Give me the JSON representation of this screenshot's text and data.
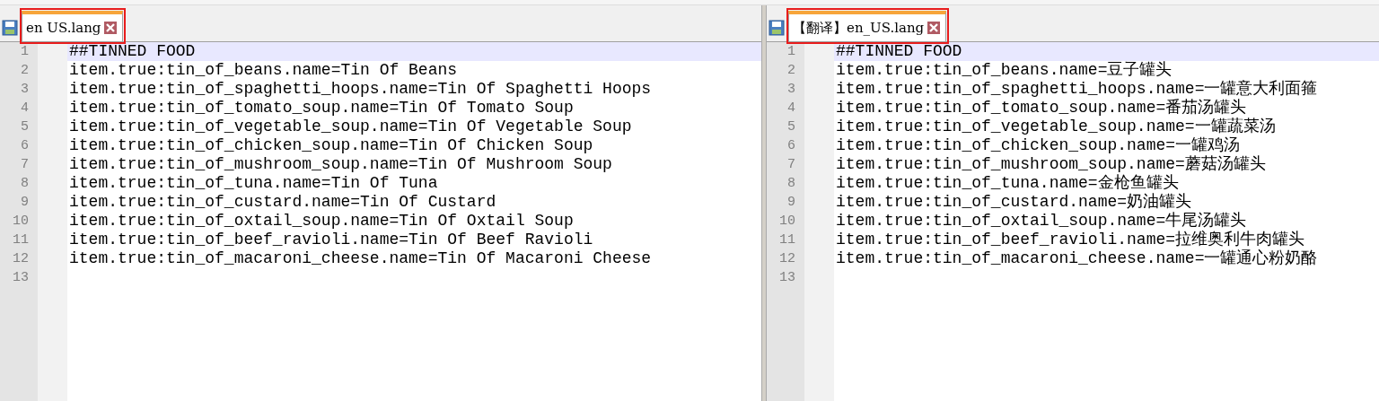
{
  "panes": [
    {
      "tab": {
        "label": "en US.lang",
        "selected": true,
        "highlighted": true
      },
      "lines": [
        {
          "number": "1",
          "text": "##TINNED FOOD",
          "current": true
        },
        {
          "number": "2",
          "text": "item.true:tin_of_beans.name=Tin Of Beans",
          "current": false
        },
        {
          "number": "3",
          "text": "item.true:tin_of_spaghetti_hoops.name=Tin Of Spaghetti Hoops",
          "current": false
        },
        {
          "number": "4",
          "text": "item.true:tin_of_tomato_soup.name=Tin Of Tomato Soup",
          "current": false
        },
        {
          "number": "5",
          "text": "item.true:tin_of_vegetable_soup.name=Tin Of Vegetable Soup",
          "current": false
        },
        {
          "number": "6",
          "text": "item.true:tin_of_chicken_soup.name=Tin Of Chicken Soup",
          "current": false
        },
        {
          "number": "7",
          "text": "item.true:tin_of_mushroom_soup.name=Tin Of Mushroom Soup",
          "current": false
        },
        {
          "number": "8",
          "text": "item.true:tin_of_tuna.name=Tin Of Tuna",
          "current": false
        },
        {
          "number": "9",
          "text": "item.true:tin_of_custard.name=Tin Of Custard",
          "current": false
        },
        {
          "number": "10",
          "text": "item.true:tin_of_oxtail_soup.name=Tin Of Oxtail Soup",
          "current": false
        },
        {
          "number": "11",
          "text": "item.true:tin_of_beef_ravioli.name=Tin Of Beef Ravioli",
          "current": false
        },
        {
          "number": "12",
          "text": "item.true:tin_of_macaroni_cheese.name=Tin Of Macaroni Cheese",
          "current": false
        },
        {
          "number": "13",
          "current": false
        }
      ]
    },
    {
      "tab": {
        "label": "【翻译】en_US.lang",
        "selected": true,
        "highlighted": true
      },
      "lines": [
        {
          "number": "1",
          "text": "##TINNED FOOD",
          "current": true
        },
        {
          "number": "2",
          "text": "item.true:tin_of_beans.name=豆子罐头",
          "current": false
        },
        {
          "number": "3",
          "text": "item.true:tin_of_spaghetti_hoops.name=一罐意大利面箍",
          "current": false
        },
        {
          "number": "4",
          "text": "item.true:tin_of_tomato_soup.name=番茄汤罐头",
          "current": false
        },
        {
          "number": "5",
          "text": "item.true:tin_of_vegetable_soup.name=一罐蔬菜汤",
          "current": false
        },
        {
          "number": "6",
          "text": "item.true:tin_of_chicken_soup.name=一罐鸡汤",
          "current": false
        },
        {
          "number": "7",
          "text": "item.true:tin_of_mushroom_soup.name=蘑菇汤罐头",
          "current": false
        },
        {
          "number": "8",
          "text": "item.true:tin_of_tuna.name=金枪鱼罐头",
          "current": false
        },
        {
          "number": "9",
          "text": "item.true:tin_of_custard.name=奶油罐头",
          "current": false
        },
        {
          "number": "10",
          "text": "item.true:tin_of_oxtail_soup.name=牛尾汤罐头",
          "current": false
        },
        {
          "number": "11",
          "text": "item.true:tin_of_beef_ravioli.name=拉维奥利牛肉罐头",
          "current": false
        },
        {
          "number": "12",
          "text": "item.true:tin_of_macaroni_cheese.name=一罐通心粉奶酪",
          "current": false
        },
        {
          "number": "13",
          "current": false
        }
      ]
    }
  ]
}
